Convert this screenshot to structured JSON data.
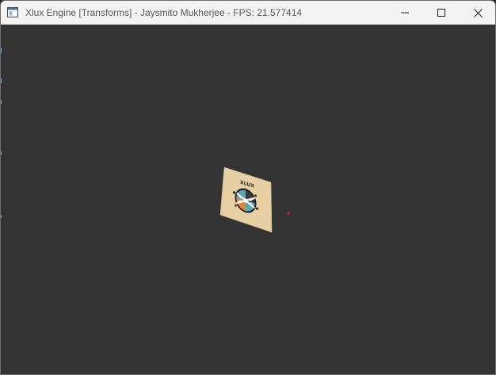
{
  "window": {
    "title": "Xlux Engine [Transforms] - Jaysmito Mukherjee - FPS: 21.577414",
    "icon": "app-window-icon",
    "controls": [
      {
        "name": "minimize",
        "icon": "minimize-icon"
      },
      {
        "name": "maximize",
        "icon": "maximize-icon"
      },
      {
        "name": "close",
        "icon": "close-icon"
      }
    ]
  },
  "viewport": {
    "background": "#333333",
    "textured_quad": {
      "texture_icon": "xlux-logo-icon",
      "texture_text": "XLUX",
      "texture_background": "#e5cfa3"
    },
    "marker_color": "#d8232a"
  }
}
